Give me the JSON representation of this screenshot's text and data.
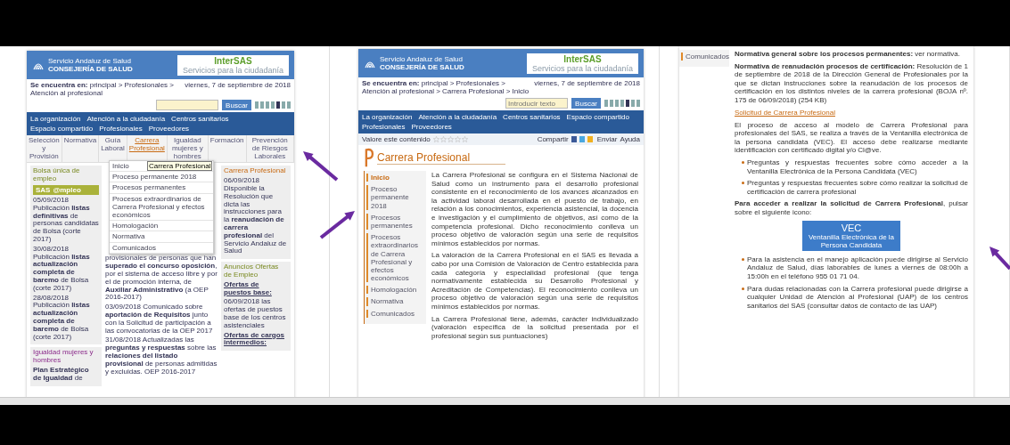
{
  "frames": [
    {
      "kind": "portal",
      "header": {
        "logo_line1": "Servicio Andaluz de Salud",
        "logo_line2": "CONSEJERÍA DE SALUD",
        "brand": "InterSAS",
        "tagline": "Servicios para la ciudadanía"
      },
      "breadcrumb": "**Se encuentra en:** principal > Profesionales > Atención al profesional",
      "date": "viernes, 7 de septiembre de 2018",
      "search": {
        "button": "Buscar"
      },
      "nav": [
        "La organización",
        "Atención a la ciudadanía",
        "Centros sanitarios",
        "Espacio compartido",
        "Profesionales",
        "Proveedores"
      ],
      "tabs": [
        {
          "label": "Selección y Provisión",
          "selected": false
        },
        {
          "label": "Normativa",
          "selected": false
        },
        {
          "label": "Guía Laboral",
          "selected": false
        },
        {
          "label": "Carrera Profesional",
          "selected": true
        },
        {
          "label": "Igualdad mujeres y hombres",
          "selected": false
        },
        {
          "label": "Formación",
          "selected": false
        },
        {
          "label": "Prevención de Riesgos Laborales",
          "selected": false
        }
      ],
      "dropdown": [
        "Inicio",
        "Proceso permanente 2018",
        "Procesos permanentes",
        "Procesos extraordinarios de Carrera Profesional y efectos económicos",
        "Homologación",
        "Normativa",
        "Comunicados"
      ],
      "tooltip": "Carrera Profesional",
      "left": {
        "title": "Bolsa única de empleo",
        "badge": [
          "SAS",
          "@mpleo"
        ],
        "news": [
          "05/09/2018 Publicación **listas definitivas** de personas candidatas de Bolsa (corte 2017)",
          "30/08/2018 Publicación **listas actualización completa de baremo** de Bolsa (corte 2017)",
          "28/08/2018 Publicación **listas actualización completa de baremo** de Bolsa (corte 2017)"
        ],
        "second_title": "Igualdad mujeres y hombres",
        "second_text": "**Plan Estratégico de Igualdad** de"
      },
      "middle": [
        "provisionales de personas que han **superado el concurso oposición**, por el sistema de acceso libre y por el de promoción interna, de **Auxiliar Administrativo** (a OEP 2016-2017)",
        "03/09/2018 Comunicado sobre **aportación de Requisitos** junto con la Solicitud de participación a las convocatorias de la OEP 2017",
        "31/08/2018 Actualizadas las **preguntas y respuestas** sobre las **relaciones del listado provisional** de personas admitidas y excluidas. OEP 2016-2017"
      ],
      "right": {
        "title": "Carrera Profesional",
        "text": "06/09/2018 Disponible la Resolución que dicta las instrucciones para la **reanudación de carrera profesional** del Servicio Andaluz de Salud",
        "second_title": "Anuncios Ofertas de Empleo",
        "links": [
          "Ofertas de puestos base:",
          "06/09/2018 las ofertas de puestos base de los centros asistenciales",
          "Ofertas de cargos intermedios:"
        ]
      }
    },
    {
      "kind": "article",
      "header": {
        "logo_line1": "Servicio Andaluz de Salud",
        "logo_line2": "CONSEJERÍA DE SALUD",
        "brand": "InterSAS",
        "tagline": "Servicios para la ciudadanía"
      },
      "breadcrumb": "**Se encuentra en:** principal > Profesionales > Atención al profesional > Carrera Profesional > Inicio",
      "date": "viernes, 7 de septiembre de 2018",
      "search": {
        "button": "Buscar",
        "placeholder": "Introducir texto"
      },
      "nav": [
        "La organización",
        "Atención a la ciudadanía",
        "Centros sanitarios",
        "Espacio compartido",
        "Profesionales",
        "Proveedores"
      ],
      "rating": {
        "label": "Valore este contenido",
        "stars": 0
      },
      "share": {
        "label": "Compartir",
        "send": "Enviar",
        "help": "Ayuda"
      },
      "title": "Carrera Profesional",
      "menu": [
        {
          "label": "Inicio",
          "selected": true
        },
        {
          "label": "Proceso permanente 2018",
          "selected": false
        },
        {
          "label": "Procesos permanentes",
          "selected": false
        },
        {
          "label": "Procesos extraordinarios de Carrera Profesional y efectos económicos",
          "selected": false
        },
        {
          "label": "Homologación",
          "selected": false
        },
        {
          "label": "Normativa",
          "selected": false
        },
        {
          "label": "Comunicados",
          "selected": false
        }
      ],
      "paragraphs": [
        "La Carrera Profesional se configura en el Sistema Nacional de Salud como un instrumento para el desarrollo profesional consistente en el reconocimiento de los avances alcanzados en la actividad laboral desarrollada en el puesto de trabajo, en relación a los conocimientos, experiencia asistencial, la docencia e investigación y el cumplimiento de objetivos, así como de la competencia profesional. Dicho reconocimiento conlleva un proceso objetivo de valoración según una serie de requisitos mínimos establecidos por normas.",
        "La valoración de la Carrera Profesional en el SAS es llevada a cabo por una Comisión de Valoración de Centro establecida para cada categoría y especialidad profesional (que tenga normativamente establecida su Desarrollo Profesional y Acreditación de Competencias). El reconocimiento conlleva un proceso objetivo de valoración según una serie de requisitos mínimos establecidos por normas.",
        "La Carrera Profesional tiene, además, carácter individualizado (valoración específica de la solicitud presentada por el profesional según sus puntuaciones)"
      ]
    },
    {
      "kind": "article_continued",
      "menu": [
        {
          "label": "Comunicados",
          "selected": false
        }
      ],
      "blocks": [
        {
          "kind": "para",
          "text": "**Normativa general sobre los procesos permanentes:** ver normativa."
        },
        {
          "kind": "para",
          "text": "**Normativa de reanudación procesos de certificación:** Resolución de 1 de septiembre de 2018 de la Dirección General de Profesionales por la que se dictan instrucciones sobre la reanudación de los procesos de certificación en los distintos niveles de la carrera profesional (BOJA nº. 175 de 06/09/2018) (254 KB)"
        },
        {
          "kind": "heading",
          "text": "Solicitud de Carrera Profesional"
        },
        {
          "kind": "para",
          "text": "El proceso de acceso al modelo de Carrera Profesional para profesionales del SAS, se realiza a través de la Ventanilla electrónica de la persona candidata (VEC). El acceso debe realizarse mediante identificación con certificado digital y/o Cl@ve."
        },
        {
          "kind": "bullet",
          "text": "Preguntas y respuestas frecuentes sobre cómo acceder a la Ventanilla Electrónica de la Persona Candidata (VEC)"
        },
        {
          "kind": "bullet",
          "text": "Preguntas y respuestas frecuentes sobre cómo realizar la solicitud de certificación de carrera profesional"
        },
        {
          "kind": "para",
          "text": "**Para acceder a realizar la solicitud de Carrera Profesional**, pulsar sobre el siguiente icono:"
        },
        {
          "kind": "vec",
          "title": "VEC",
          "text": "Ventanilla Electrónica de la Persona Candidata"
        },
        {
          "kind": "bullet",
          "text": "Para la asistencia en el manejo aplicación puede dirigirse al Servicio Andaluz de Salud, días laborables de lunes a viernes de 08:00h a 15:00h en el teléfono 955 01 71 04."
        },
        {
          "kind": "bullet",
          "text": "Para dudas relacionadas con la Carrera profesional puede dirigirse a cualquier Unidad de Atención al Profesional (UAP) de los centros sanitarios del SAS (consultar datos de contacto de las UAP)"
        }
      ]
    }
  ]
}
